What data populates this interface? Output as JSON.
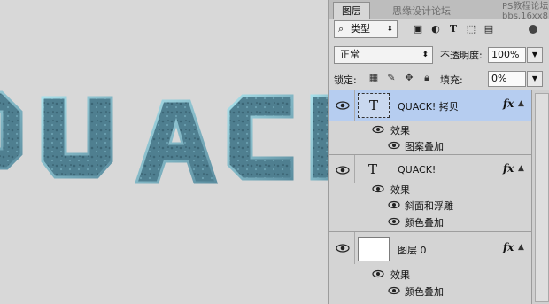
{
  "canvas": {
    "art_text": "QUAC"
  },
  "panel": {
    "tab_label": "图层",
    "watermark": "思缘设计论坛",
    "watermark2_line1": "PS教程论坛",
    "watermark2_line2": "bbs.16xx8.com",
    "filter": {
      "label": "类型"
    },
    "blend_mode": "正常",
    "opacity_label": "不透明度:",
    "opacity_value": "100%",
    "lock_label": "锁定:",
    "fill_label": "填充:",
    "fill_value": "0%"
  },
  "layers": [
    {
      "name": "QUACK! 拷贝",
      "kind": "text",
      "thumb_glyph": "T",
      "selected": true,
      "has_fx": true,
      "effects_label": "效果",
      "effects": [
        "图案叠加"
      ]
    },
    {
      "name": "QUACK!",
      "kind": "text",
      "thumb_glyph": "T",
      "selected": false,
      "has_fx": true,
      "effects_label": "效果",
      "effects": [
        "斜面和浮雕",
        "颜色叠加"
      ]
    },
    {
      "name": "图层 0",
      "kind": "pixel",
      "thumb_glyph": "",
      "selected": false,
      "has_fx": true,
      "effects_label": "效果",
      "effects": [
        "颜色叠加"
      ]
    }
  ],
  "fx_label": "fx",
  "colors": {
    "selected_row": "#b6cdf0",
    "art_fill": "#4f7f90",
    "art_edge": "#9fd6e1"
  }
}
